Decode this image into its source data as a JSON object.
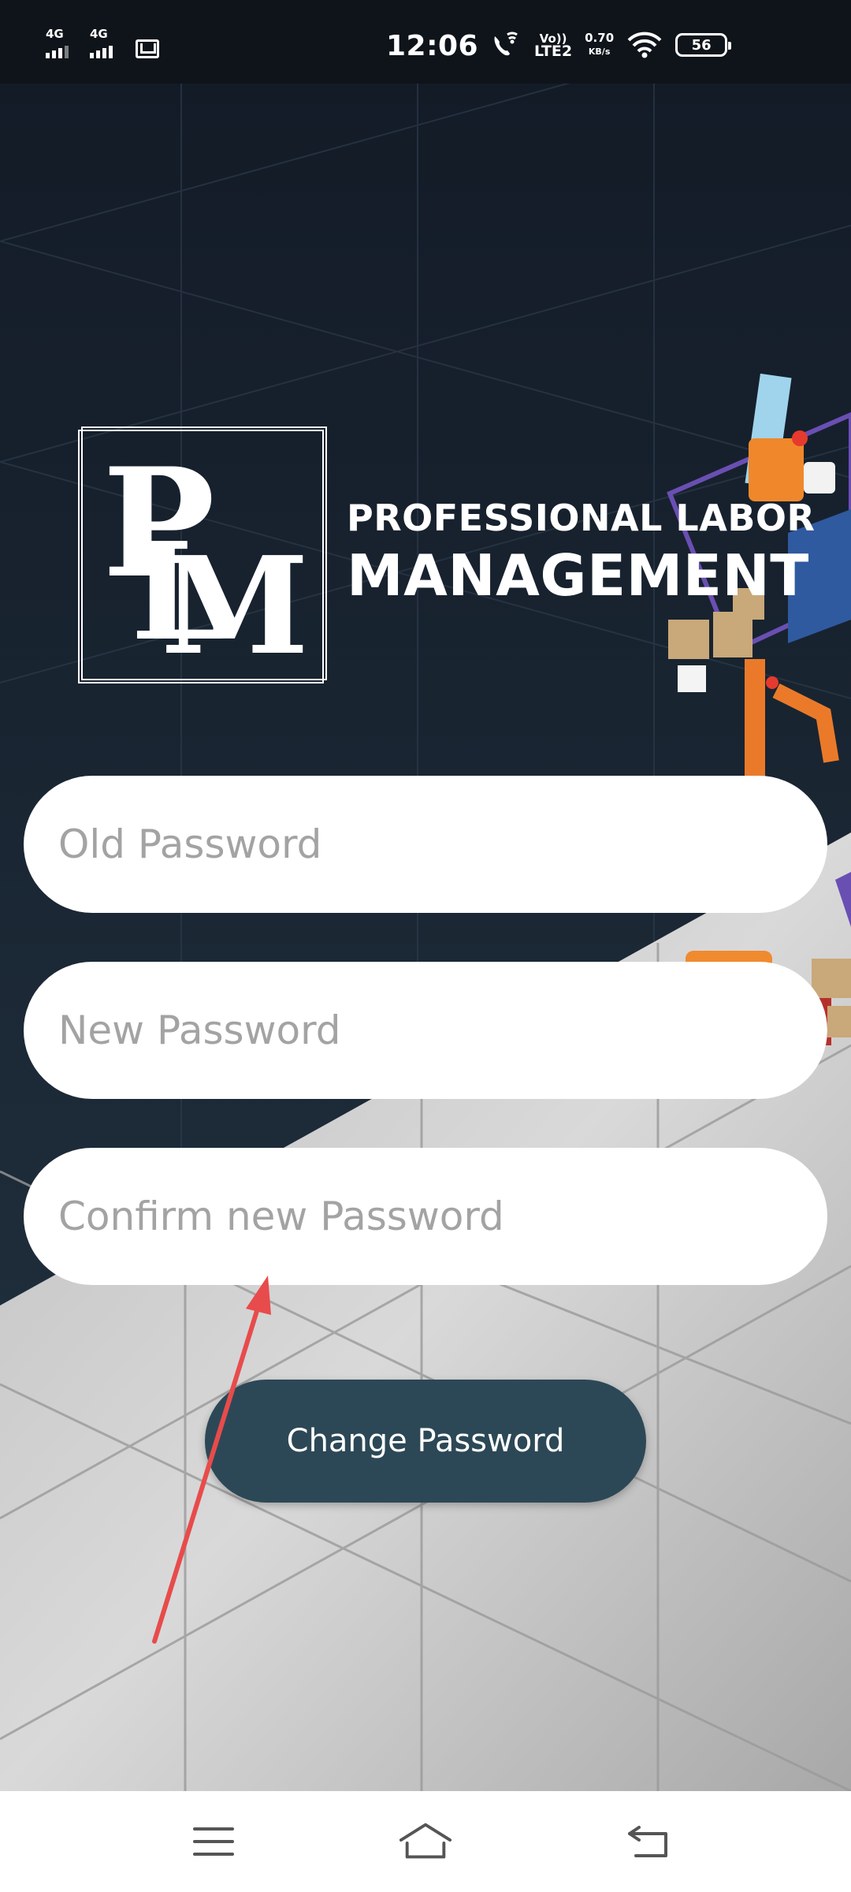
{
  "status_bar": {
    "sim1": "4G",
    "sim2": "4G",
    "time": "12:06",
    "volte_line1": "Vo))",
    "volte_line2": "LTE2",
    "net_speed": "0.70",
    "net_speed_unit": "KB/s",
    "battery_level": "56"
  },
  "brand": {
    "logo_text": "PLM",
    "line1": "PROFESSIONAL LABOR",
    "line2": "MANAGEMENT"
  },
  "form": {
    "old_password_placeholder": "Old Password",
    "new_password_placeholder": "New Password",
    "confirm_password_placeholder": "Confirm new Password",
    "submit_label": "Change Password"
  },
  "nav_bar": {
    "menu_icon": "menu-icon",
    "home_icon": "home-icon",
    "back_icon": "back-icon"
  },
  "colors": {
    "background_dark": "#1a2330",
    "floor_light": "#d8d8d8",
    "button": "#2c4856",
    "annotation_arrow": "#e84b4b"
  }
}
